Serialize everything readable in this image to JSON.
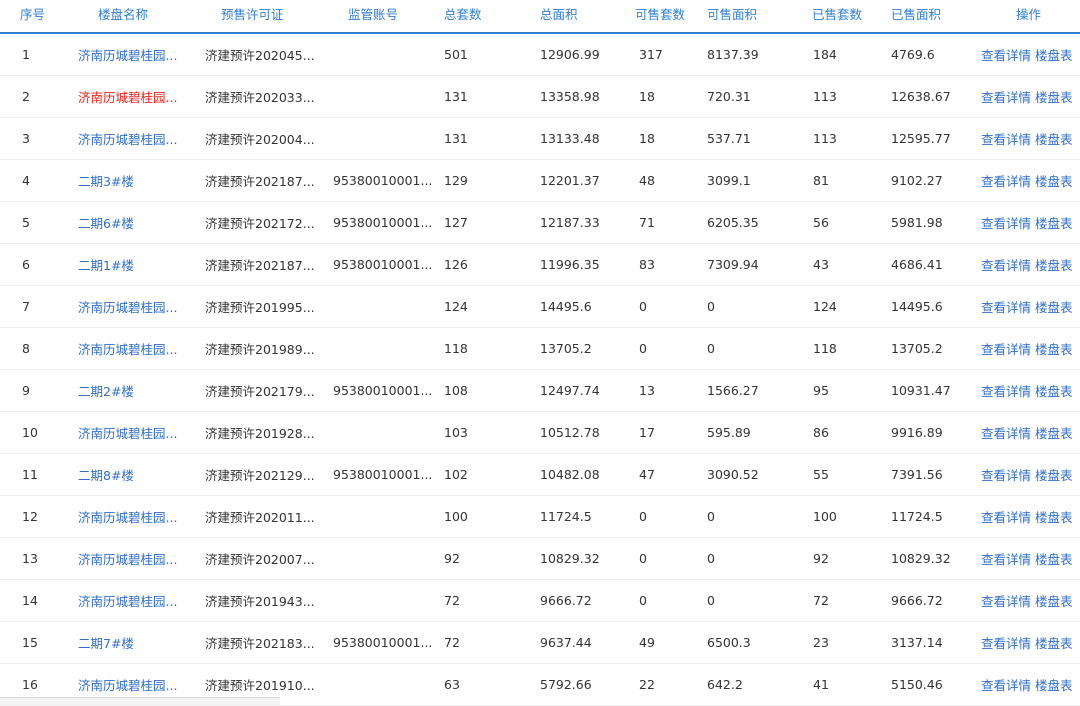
{
  "columns": [
    "序号",
    "楼盘名称",
    "预售许可证",
    "监管账号",
    "总套数",
    "总面积",
    "可售套数",
    "可售面积",
    "已售套数",
    "已售面积",
    "操作"
  ],
  "actions": {
    "detail": "查看详情",
    "table": "楼盘表"
  },
  "rows": [
    {
      "no": "1",
      "name": "济南历城碧桂园...",
      "permit": "济建预许202045...",
      "account": "",
      "total": "501",
      "area": "12906.99",
      "avail": "317",
      "avail_area": "8137.39",
      "sold": "184",
      "sold_area": "4769.6",
      "hot": false
    },
    {
      "no": "2",
      "name": "济南历城碧桂园...",
      "permit": "济建预许202033...",
      "account": "",
      "total": "131",
      "area": "13358.98",
      "avail": "18",
      "avail_area": "720.31",
      "sold": "113",
      "sold_area": "12638.67",
      "hot": true
    },
    {
      "no": "3",
      "name": "济南历城碧桂园...",
      "permit": "济建预许202004...",
      "account": "",
      "total": "131",
      "area": "13133.48",
      "avail": "18",
      "avail_area": "537.71",
      "sold": "113",
      "sold_area": "12595.77",
      "hot": false
    },
    {
      "no": "4",
      "name": "二期3#楼",
      "permit": "济建预许202187...",
      "account": "95380010001...",
      "total": "129",
      "area": "12201.37",
      "avail": "48",
      "avail_area": "3099.1",
      "sold": "81",
      "sold_area": "9102.27",
      "hot": false
    },
    {
      "no": "5",
      "name": "二期6#楼",
      "permit": "济建预许202172...",
      "account": "95380010001...",
      "total": "127",
      "area": "12187.33",
      "avail": "71",
      "avail_area": "6205.35",
      "sold": "56",
      "sold_area": "5981.98",
      "hot": false
    },
    {
      "no": "6",
      "name": "二期1#楼",
      "permit": "济建预许202187...",
      "account": "95380010001...",
      "total": "126",
      "area": "11996.35",
      "avail": "83",
      "avail_area": "7309.94",
      "sold": "43",
      "sold_area": "4686.41",
      "hot": false
    },
    {
      "no": "7",
      "name": "济南历城碧桂园...",
      "permit": "济建预许201995...",
      "account": "",
      "total": "124",
      "area": "14495.6",
      "avail": "0",
      "avail_area": "0",
      "sold": "124",
      "sold_area": "14495.6",
      "hot": false
    },
    {
      "no": "8",
      "name": "济南历城碧桂园...",
      "permit": "济建预许201989...",
      "account": "",
      "total": "118",
      "area": "13705.2",
      "avail": "0",
      "avail_area": "0",
      "sold": "118",
      "sold_area": "13705.2",
      "hot": false
    },
    {
      "no": "9",
      "name": "二期2#楼",
      "permit": "济建预许202179...",
      "account": "95380010001...",
      "total": "108",
      "area": "12497.74",
      "avail": "13",
      "avail_area": "1566.27",
      "sold": "95",
      "sold_area": "10931.47",
      "hot": false
    },
    {
      "no": "10",
      "name": "济南历城碧桂园...",
      "permit": "济建预许201928...",
      "account": "",
      "total": "103",
      "area": "10512.78",
      "avail": "17",
      "avail_area": "595.89",
      "sold": "86",
      "sold_area": "9916.89",
      "hot": false
    },
    {
      "no": "11",
      "name": "二期8#楼",
      "permit": "济建预许202129...",
      "account": "95380010001...",
      "total": "102",
      "area": "10482.08",
      "avail": "47",
      "avail_area": "3090.52",
      "sold": "55",
      "sold_area": "7391.56",
      "hot": false
    },
    {
      "no": "12",
      "name": "济南历城碧桂园...",
      "permit": "济建预许202011...",
      "account": "",
      "total": "100",
      "area": "11724.5",
      "avail": "0",
      "avail_area": "0",
      "sold": "100",
      "sold_area": "11724.5",
      "hot": false
    },
    {
      "no": "13",
      "name": "济南历城碧桂园...",
      "permit": "济建预许202007...",
      "account": "",
      "total": "92",
      "area": "10829.32",
      "avail": "0",
      "avail_area": "0",
      "sold": "92",
      "sold_area": "10829.32",
      "hot": false
    },
    {
      "no": "14",
      "name": "济南历城碧桂园...",
      "permit": "济建预许201943...",
      "account": "",
      "total": "72",
      "area": "9666.72",
      "avail": "0",
      "avail_area": "0",
      "sold": "72",
      "sold_area": "9666.72",
      "hot": false
    },
    {
      "no": "15",
      "name": "二期7#楼",
      "permit": "济建预许202183...",
      "account": "95380010001...",
      "total": "72",
      "area": "9637.44",
      "avail": "49",
      "avail_area": "6500.3",
      "sold": "23",
      "sold_area": "3137.14",
      "hot": false
    },
    {
      "no": "16",
      "name": "济南历城碧桂园...",
      "permit": "济建预许201910...",
      "account": "",
      "total": "63",
      "area": "5792.66",
      "avail": "22",
      "avail_area": "642.2",
      "sold": "41",
      "sold_area": "5150.46",
      "hot": false
    }
  ],
  "colors": {
    "header_text": "#2f7fd3",
    "link": "#2f6fc8",
    "highlight": "#e8261d"
  }
}
